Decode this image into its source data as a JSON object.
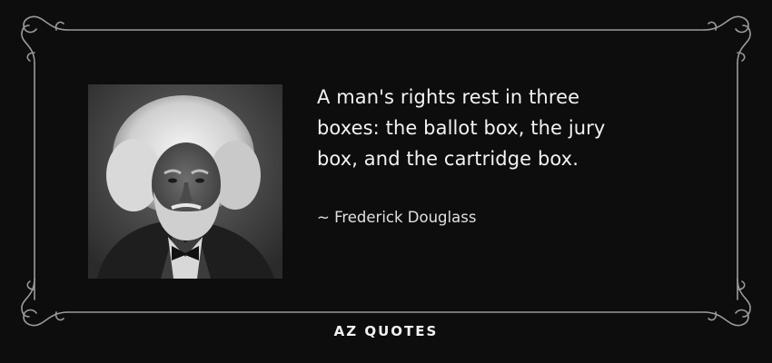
{
  "quote": {
    "text": "A man's rights rest in three\nboxes: the ballot box, the jury\nbox, and the cartridge box.",
    "author": "~ Frederick Douglass"
  },
  "brand": {
    "name": "AZ QUOTES"
  },
  "colors": {
    "background": "#0d0d0d",
    "text": "#f2f2f2",
    "border": "#9a9a9a"
  },
  "portrait": {
    "icon": "portrait-photo"
  }
}
